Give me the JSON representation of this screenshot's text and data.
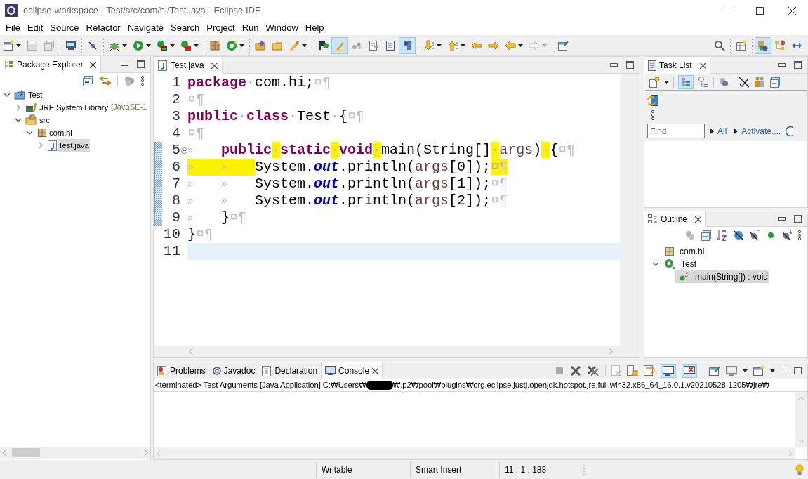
{
  "window": {
    "title": "eclipse-workspace - Test/src/com/hi/Test.java - Eclipse IDE"
  },
  "menu": [
    "File",
    "Edit",
    "Source",
    "Refactor",
    "Navigate",
    "Search",
    "Project",
    "Run",
    "Window",
    "Help"
  ],
  "toolbar": {
    "groups": [
      [
        {
          "selected": false,
          "dropdown": true
        },
        {
          "selected": false,
          "dropdown": false
        },
        {
          "selected": false,
          "dropdown": false
        }
      ],
      [
        {
          "selected": false,
          "dropdown": false
        }
      ],
      [
        {
          "selected": false,
          "dropdown": false
        }
      ],
      [
        {
          "selected": false,
          "dropdown": true
        },
        {
          "selected": false,
          "dropdown": true
        },
        {
          "selected": false,
          "dropdown": true
        },
        {
          "selected": false,
          "dropdown": true
        }
      ],
      [
        {
          "selected": false,
          "dropdown": false
        },
        {
          "selected": false,
          "dropdown": true
        }
      ],
      [
        {
          "selected": false,
          "dropdown": false
        },
        {
          "selected": false,
          "dropdown": false
        },
        {
          "selected": false,
          "dropdown": true
        }
      ],
      [
        {
          "selected": false,
          "dropdown": false
        },
        {
          "selected": true,
          "dropdown": false
        },
        {
          "selected": false,
          "dropdown": false
        },
        {
          "selected": false,
          "dropdown": false
        },
        {
          "selected": false,
          "dropdown": false
        },
        {
          "selected": true,
          "dropdown": false
        }
      ],
      [
        {
          "selected": false,
          "dropdown": true
        },
        {
          "selected": false,
          "dropdown": true
        },
        {
          "selected": false,
          "dropdown": false
        },
        {
          "selected": false,
          "dropdown": false
        },
        {
          "selected": false,
          "dropdown": true
        },
        {
          "selected": false,
          "dropdown": true
        }
      ],
      [
        {
          "selected": false,
          "dropdown": false
        }
      ]
    ],
    "right": [
      [
        {
          "selected": false,
          "dropdown": false
        }
      ],
      [
        {
          "selected": false,
          "dropdown": false
        }
      ],
      [
        {
          "selected": true,
          "dropdown": false
        },
        {
          "selected": false,
          "dropdown": false
        },
        {
          "selected": false,
          "dropdown": false
        }
      ]
    ]
  },
  "package_explorer": {
    "tab": "Package Explorer",
    "tree": [
      {
        "label": "Test",
        "expanded": true,
        "selected": false,
        "children": [
          {
            "label": "JRE System Library",
            "decoration": "[JavaSE-1",
            "expanded": false,
            "selected": false
          },
          {
            "label": "src",
            "expanded": true,
            "selected": false,
            "children": [
              {
                "label": "com.hi",
                "expanded": true,
                "selected": false,
                "children": [
                  {
                    "label": "Test.java",
                    "expanded": false,
                    "selected": true
                  }
                ]
              }
            ]
          }
        ]
      }
    ]
  },
  "editor": {
    "tab": {
      "label": "Test.java",
      "selected": true
    },
    "lines": [
      {
        "no": "1",
        "fold": false,
        "changed": false,
        "current": false,
        "tokens": [
          {
            "kind": "kw",
            "text": "package"
          },
          {
            "kind": "ws",
            "text": "·"
          },
          {
            "kind": "plain",
            "text": "com.hi;"
          },
          {
            "kind": "eol",
            "text": "¤¶"
          }
        ]
      },
      {
        "no": "2",
        "fold": false,
        "changed": false,
        "current": false,
        "tokens": [
          {
            "kind": "eol",
            "text": "¤¶"
          }
        ]
      },
      {
        "no": "3",
        "fold": false,
        "changed": false,
        "current": false,
        "tokens": [
          {
            "kind": "kw",
            "text": "public"
          },
          {
            "kind": "ws",
            "text": "·"
          },
          {
            "kind": "kw",
            "text": "class"
          },
          {
            "kind": "ws",
            "text": "·"
          },
          {
            "kind": "plain",
            "text": "Test"
          },
          {
            "kind": "ws",
            "text": "·"
          },
          {
            "kind": "plain",
            "text": "{"
          },
          {
            "kind": "eol",
            "text": "¤¶"
          }
        ]
      },
      {
        "no": "4",
        "fold": false,
        "changed": false,
        "current": false,
        "tokens": [
          {
            "kind": "eol",
            "text": "¤¶"
          }
        ]
      },
      {
        "no": "5",
        "fold": true,
        "changed": true,
        "current": false,
        "tokens": [
          {
            "kind": "tab",
            "text": "»"
          },
          {
            "kind": "kw",
            "text": "public"
          },
          {
            "kind": "ws-hl",
            "text": "·"
          },
          {
            "kind": "kw",
            "text": "static"
          },
          {
            "kind": "ws-hl",
            "text": "·"
          },
          {
            "kind": "kw",
            "text": "void"
          },
          {
            "kind": "ws-hl",
            "text": "·"
          },
          {
            "kind": "plain",
            "text": "main(String[]"
          },
          {
            "kind": "ws-hl",
            "text": "·"
          },
          {
            "kind": "var",
            "text": "args"
          },
          {
            "kind": "plain",
            "text": ")"
          },
          {
            "kind": "ws-hl",
            "text": "·"
          },
          {
            "kind": "plain",
            "text": "{"
          },
          {
            "kind": "eol",
            "text": "¤¶"
          }
        ]
      },
      {
        "no": "6",
        "fold": false,
        "changed": true,
        "current": false,
        "tokens": [
          {
            "kind": "tab-hl",
            "text": "»"
          },
          {
            "kind": "tab-hl",
            "text": "»"
          },
          {
            "kind": "plain",
            "text": "System."
          },
          {
            "kind": "field",
            "text": "out"
          },
          {
            "kind": "plain",
            "text": ".println("
          },
          {
            "kind": "var",
            "text": "args"
          },
          {
            "kind": "plain",
            "text": "[0]);"
          },
          {
            "kind": "eol-hl",
            "text": "¤¶"
          }
        ]
      },
      {
        "no": "7",
        "fold": false,
        "changed": true,
        "current": false,
        "tokens": [
          {
            "kind": "tab",
            "text": "»"
          },
          {
            "kind": "tab",
            "text": "»"
          },
          {
            "kind": "plain",
            "text": "System."
          },
          {
            "kind": "field",
            "text": "out"
          },
          {
            "kind": "plain",
            "text": ".println("
          },
          {
            "kind": "var",
            "text": "args"
          },
          {
            "kind": "plain",
            "text": "[1]);"
          },
          {
            "kind": "eol",
            "text": "¤¶"
          }
        ]
      },
      {
        "no": "8",
        "fold": false,
        "changed": true,
        "current": false,
        "tokens": [
          {
            "kind": "tab",
            "text": "»"
          },
          {
            "kind": "tab",
            "text": "»"
          },
          {
            "kind": "plain",
            "text": "System."
          },
          {
            "kind": "field",
            "text": "out"
          },
          {
            "kind": "plain",
            "text": ".println("
          },
          {
            "kind": "var",
            "text": "args"
          },
          {
            "kind": "plain",
            "text": "[2]);"
          },
          {
            "kind": "eol",
            "text": "¤¶"
          }
        ]
      },
      {
        "no": "9",
        "fold": false,
        "changed": true,
        "current": false,
        "tokens": [
          {
            "kind": "tab",
            "text": "»"
          },
          {
            "kind": "plain",
            "text": "}"
          },
          {
            "kind": "eol",
            "text": "¤¶"
          }
        ]
      },
      {
        "no": "10",
        "fold": false,
        "changed": false,
        "current": false,
        "tokens": [
          {
            "kind": "plain",
            "text": "}"
          },
          {
            "kind": "eol",
            "text": "¤¶"
          }
        ]
      },
      {
        "no": "11",
        "fold": false,
        "changed": false,
        "current": true
      }
    ]
  },
  "task_list": {
    "tab": "Task List",
    "find": {
      "placeholder": "Find"
    },
    "links": [
      "All",
      "Activate...."
    ]
  },
  "outline": {
    "tab": "Outline",
    "tree": [
      {
        "label": "com.hi",
        "kind": "package",
        "expanded": false,
        "selected": false
      },
      {
        "label": "Test",
        "kind": "class",
        "expanded": true,
        "selected": false,
        "children": [
          {
            "label": "main(String[]) : void",
            "kind": "method",
            "expanded": false,
            "selected": true
          }
        ]
      }
    ]
  },
  "bottom": {
    "tabs": [
      {
        "label": "Problems",
        "selected": false
      },
      {
        "label": "Javadoc",
        "selected": false
      },
      {
        "label": "Declaration",
        "selected": false
      },
      {
        "label": "Console",
        "selected": true
      }
    ],
    "console_header": [
      "<terminated> Test Arguments [Java Application] C:₩Users₩",
      "₩.p2₩pool₩plugins₩org.eclipse.justj.openjdk.hotspot.jre.full.win32.x86_64_16.0.1.v20210528-1205₩jre₩"
    ]
  },
  "status_bar": [
    "Writable",
    "Smart Insert",
    "11 : 1 : 188"
  ]
}
